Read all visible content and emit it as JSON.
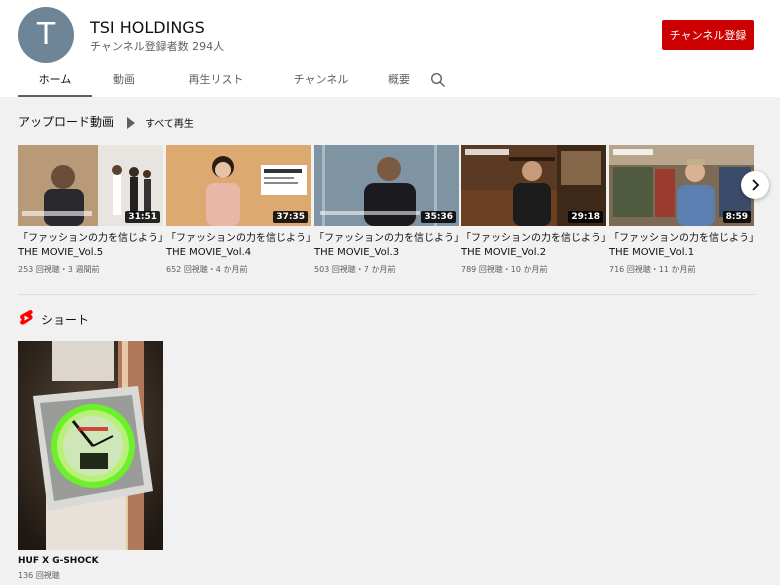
{
  "channel": {
    "avatar_letter": "T",
    "name": "TSI HOLDINGS",
    "subscribers": "チャンネル登録者数 294人",
    "subscribe_label": "チャンネル登録"
  },
  "tabs": [
    {
      "label": "ホーム",
      "active": true
    },
    {
      "label": "動画"
    },
    {
      "label": "再生リスト"
    },
    {
      "label": "チャンネル"
    },
    {
      "label": "概要"
    }
  ],
  "uploads": {
    "title": "アップロード動画",
    "play_all": "すべて再生",
    "videos": [
      {
        "title": "「ファッションの力を信じよう」THE MOVIE_Vol.5",
        "duration": "31:51",
        "meta": "253 回視聴・3 週間前"
      },
      {
        "title": "「ファッションの力を信じよう」THE MOVIE_Vol.4",
        "duration": "37:35",
        "meta": "652 回視聴・4 か月前"
      },
      {
        "title": "「ファッションの力を信じよう」THE MOVIE_Vol.3",
        "duration": "35:36",
        "meta": "503 回視聴・7 か月前"
      },
      {
        "title": "「ファッションの力を信じよう」THE MOVIE_Vol.2",
        "duration": "29:18",
        "meta": "789 回視聴・10 か月前"
      },
      {
        "title": "「ファッションの力を信じよう」THE MOVIE_Vol.1",
        "duration": "8:59",
        "meta": "716 回視聴・11 か月前"
      }
    ]
  },
  "shorts": {
    "title": "ショート",
    "items": [
      {
        "title": "HUF X G-SHOCK",
        "meta": "136 回視聴"
      }
    ]
  },
  "colors": {
    "accent": "#cc0000",
    "background": "#f1f1f1",
    "header": "#ffffff",
    "secondary_text": "#606060"
  }
}
